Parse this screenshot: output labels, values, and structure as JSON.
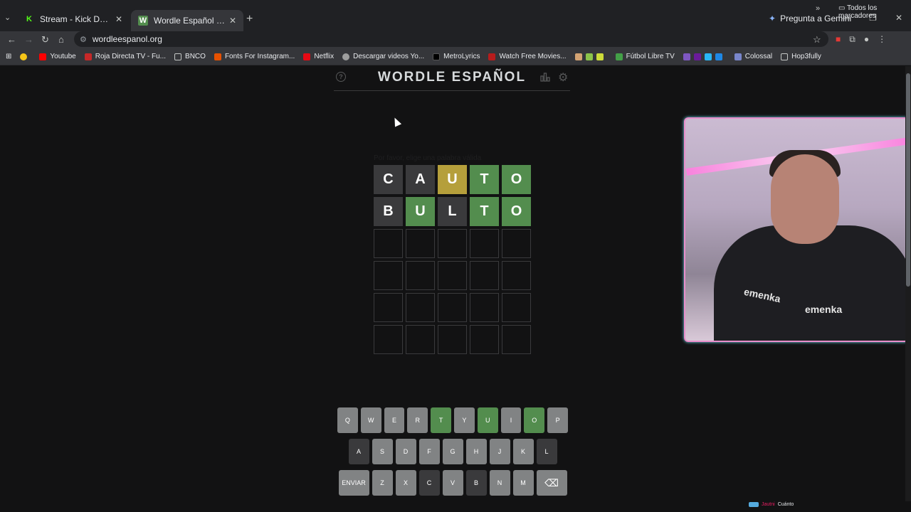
{
  "browser": {
    "tabs": [
      {
        "title": "Stream - Kick Dashboard",
        "favicon": "K",
        "active": false,
        "color": "#53fc18"
      },
      {
        "title": "Wordle Español - Wordle ilimitado",
        "favicon": "W",
        "active": true,
        "color": "#538d4e"
      }
    ],
    "gemini_label": "Pregunta a Gemini",
    "url": "wordleespanol.org",
    "bookmarks": [
      "Youtube",
      "Roja Directa TV - Fu...",
      "BNCO",
      "Fonts For Instagram...",
      "Netflix",
      "Descargar videos Yo...",
      "MetroLyrics",
      "Watch Free Movies...",
      "Fútbol Libre TV",
      "Colossal",
      "Hop3fully"
    ],
    "all_bookmarks": "Todos los marcadores"
  },
  "game": {
    "title": "WORDLE ESPAÑOL",
    "ghost_text": "Por favor, elige una palabra válida",
    "board": [
      [
        {
          "letter": "C",
          "state": "absent"
        },
        {
          "letter": "A",
          "state": "absent"
        },
        {
          "letter": "U",
          "state": "present"
        },
        {
          "letter": "T",
          "state": "correct"
        },
        {
          "letter": "O",
          "state": "correct"
        }
      ],
      [
        {
          "letter": "B",
          "state": "absent"
        },
        {
          "letter": "U",
          "state": "correct"
        },
        {
          "letter": "L",
          "state": "absent"
        },
        {
          "letter": "T",
          "state": "correct"
        },
        {
          "letter": "O",
          "state": "correct"
        }
      ],
      [
        {
          "letter": "",
          "state": "empty"
        },
        {
          "letter": "",
          "state": "empty"
        },
        {
          "letter": "",
          "state": "empty"
        },
        {
          "letter": "",
          "state": "empty"
        },
        {
          "letter": "",
          "state": "empty"
        }
      ],
      [
        {
          "letter": "",
          "state": "empty"
        },
        {
          "letter": "",
          "state": "empty"
        },
        {
          "letter": "",
          "state": "empty"
        },
        {
          "letter": "",
          "state": "empty"
        },
        {
          "letter": "",
          "state": "empty"
        }
      ],
      [
        {
          "letter": "",
          "state": "empty"
        },
        {
          "letter": "",
          "state": "empty"
        },
        {
          "letter": "",
          "state": "empty"
        },
        {
          "letter": "",
          "state": "empty"
        },
        {
          "letter": "",
          "state": "empty"
        }
      ],
      [
        {
          "letter": "",
          "state": "empty"
        },
        {
          "letter": "",
          "state": "empty"
        },
        {
          "letter": "",
          "state": "empty"
        },
        {
          "letter": "",
          "state": "empty"
        },
        {
          "letter": "",
          "state": "empty"
        }
      ]
    ],
    "keyboard": [
      [
        {
          "k": "Q",
          "s": ""
        },
        {
          "k": "W",
          "s": ""
        },
        {
          "k": "E",
          "s": ""
        },
        {
          "k": "R",
          "s": ""
        },
        {
          "k": "T",
          "s": "correct"
        },
        {
          "k": "Y",
          "s": ""
        },
        {
          "k": "U",
          "s": "correct"
        },
        {
          "k": "I",
          "s": ""
        },
        {
          "k": "O",
          "s": "correct"
        },
        {
          "k": "P",
          "s": ""
        }
      ],
      [
        {
          "k": "A",
          "s": "absent"
        },
        {
          "k": "S",
          "s": ""
        },
        {
          "k": "D",
          "s": ""
        },
        {
          "k": "F",
          "s": ""
        },
        {
          "k": "G",
          "s": ""
        },
        {
          "k": "H",
          "s": ""
        },
        {
          "k": "J",
          "s": ""
        },
        {
          "k": "K",
          "s": ""
        },
        {
          "k": "L",
          "s": "absent"
        }
      ],
      [
        {
          "k": "ENVIAR",
          "s": "",
          "wide": true
        },
        {
          "k": "Z",
          "s": ""
        },
        {
          "k": "X",
          "s": ""
        },
        {
          "k": "C",
          "s": "absent"
        },
        {
          "k": "V",
          "s": ""
        },
        {
          "k": "B",
          "s": "absent"
        },
        {
          "k": "N",
          "s": ""
        },
        {
          "k": "M",
          "s": ""
        },
        {
          "k": "⌫",
          "s": "",
          "wide": true
        }
      ]
    ],
    "colors": {
      "correct": "#538d4e",
      "present": "#b59f3b",
      "absent": "#3a3a3c",
      "key": "#818384"
    }
  },
  "webcam": {
    "brand_text": "emenka"
  },
  "stream_tag": {
    "name": "Jautni",
    "label": "Cuánto"
  }
}
